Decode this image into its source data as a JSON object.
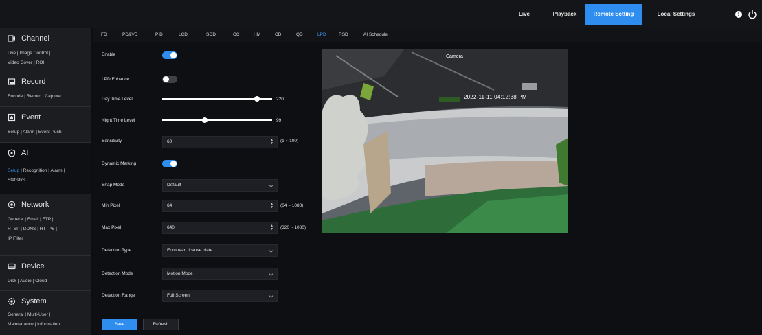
{
  "topnav": {
    "live": "Live",
    "playback": "Playback",
    "remote_setting": "Remote Setting",
    "local_settings": "Local Settings",
    "alert": "!"
  },
  "sidebar": {
    "channel": {
      "title": "Channel",
      "line1": "Live | Image Control |",
      "line2": "Video Cover | ROI"
    },
    "record": {
      "title": "Record",
      "line1": "Encode | Record | Capture"
    },
    "event": {
      "title": "Event",
      "line1": "Setup | Alarm | Event Push"
    },
    "ai": {
      "title": "AI",
      "setup": "Setup",
      "line1_rest": " | Recognition | Alarm |",
      "line2": "Statistics"
    },
    "network": {
      "title": "Network",
      "line1": "General | Email | FTP |",
      "line2": "RTSP | DDNS | HTTPS |",
      "line3": "IP Filter"
    },
    "device": {
      "title": "Device",
      "line1": "Disk | Audio | Cloud"
    },
    "system": {
      "title": "System",
      "line1": "General | Multi-User |",
      "line2": "Maintenance | Information"
    }
  },
  "tabs": [
    "FD",
    "PD&VD",
    "PID",
    "LCD",
    "SOD",
    "CC",
    "HM",
    "CD",
    "QD",
    "LPD",
    "RSD",
    "AI Schedule"
  ],
  "active_tab": "LPD",
  "form": {
    "enable": {
      "label": "Enable",
      "on": true
    },
    "lpd_enhance": {
      "label": "LPD Enhance",
      "on": false
    },
    "day_time_level": {
      "label": "Day Time Level",
      "value": "220",
      "fraction": 0.86
    },
    "night_time_level": {
      "label": "Night Time Level",
      "value": "99",
      "fraction": 0.39
    },
    "sensitivity": {
      "label": "Sensitivity",
      "value": "60",
      "range": "(1 ~ 100)"
    },
    "dynamic_marking": {
      "label": "Dynamic Marking",
      "on": true
    },
    "snap_mode": {
      "label": "Snap Mode",
      "value": "Default"
    },
    "min_pixel": {
      "label": "Min Pixel",
      "value": "64",
      "range": "(64 ~ 1080)"
    },
    "max_pixel": {
      "label": "Max Pixel",
      "value": "640",
      "range": "(320 ~ 1080)"
    },
    "detection_type": {
      "label": "Detection Type",
      "value": "European license plate"
    },
    "detection_mode": {
      "label": "Detection Mode",
      "value": "Motion Mode"
    },
    "detection_range": {
      "label": "Detection Range",
      "value": "Full Screen"
    }
  },
  "buttons": {
    "save": "Save",
    "refresh": "Refresh"
  },
  "preview": {
    "camera_name": "Camera",
    "timestamp": "2022-11-11 04:12:38 PM"
  },
  "colors": {
    "accent": "#2e8dee",
    "background": "#0e0f12",
    "sidebar": "#1b1d21"
  }
}
